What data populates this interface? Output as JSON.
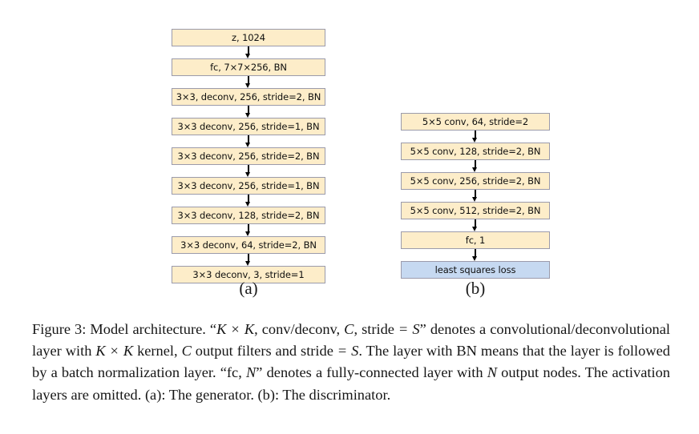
{
  "figure": {
    "generator": {
      "label": "(a)",
      "nodes": [
        {
          "text": "z, 1024",
          "kind": "layer"
        },
        {
          "text": "fc, 7×7×256, BN",
          "kind": "layer"
        },
        {
          "text": "3×3, deconv, 256, stride=2, BN",
          "kind": "layer"
        },
        {
          "text": "3×3 deconv, 256, stride=1, BN",
          "kind": "layer"
        },
        {
          "text": "3×3 deconv, 256, stride=2, BN",
          "kind": "layer"
        },
        {
          "text": "3×3 deconv, 256, stride=1, BN",
          "kind": "layer"
        },
        {
          "text": "3×3 deconv, 128, stride=2, BN",
          "kind": "layer"
        },
        {
          "text": "3×3 deconv, 64, stride=2, BN",
          "kind": "layer"
        },
        {
          "text": "3×3 deconv, 3, stride=1",
          "kind": "layer"
        }
      ]
    },
    "discriminator": {
      "label": "(b)",
      "nodes": [
        {
          "text": "5×5 conv, 64, stride=2",
          "kind": "layer"
        },
        {
          "text": "5×5 conv, 128, stride=2, BN",
          "kind": "layer"
        },
        {
          "text": "5×5 conv, 256, stride=2, BN",
          "kind": "layer"
        },
        {
          "text": "5×5 conv, 512, stride=2, BN",
          "kind": "layer"
        },
        {
          "text": "fc, 1",
          "kind": "layer"
        },
        {
          "text": "least squares loss",
          "kind": "loss"
        }
      ]
    },
    "colors": {
      "layer_fill": "#fdedc9",
      "loss_fill": "#c6d9f1",
      "node_border": "#9b9bab",
      "arrow": "#000000"
    }
  },
  "caption": {
    "number": "Figure 3:",
    "segments": [
      {
        "t": "Figure 3:",
        "s": "plain"
      },
      {
        "t": " Model architecture. “",
        "s": "plain"
      },
      {
        "t": "K",
        "s": "math"
      },
      {
        "t": " × ",
        "s": "op"
      },
      {
        "t": "K",
        "s": "math"
      },
      {
        "t": ", conv/deconv, ",
        "s": "plain"
      },
      {
        "t": "C",
        "s": "math"
      },
      {
        "t": ", stride ",
        "s": "plain"
      },
      {
        "t": "= ",
        "s": "op"
      },
      {
        "t": "S",
        "s": "math"
      },
      {
        "t": "” denotes a convolutional/deconvolutional layer with ",
        "s": "plain"
      },
      {
        "t": "K",
        "s": "math"
      },
      {
        "t": " × ",
        "s": "op"
      },
      {
        "t": "K",
        "s": "math"
      },
      {
        "t": " kernel, ",
        "s": "plain"
      },
      {
        "t": "C",
        "s": "math"
      },
      {
        "t": " output filters and stride ",
        "s": "plain"
      },
      {
        "t": "= ",
        "s": "op"
      },
      {
        "t": "S",
        "s": "math"
      },
      {
        "t": ". The layer with BN means that the layer is followed by a batch normalization layer. “fc, ",
        "s": "plain"
      },
      {
        "t": "N",
        "s": "math"
      },
      {
        "t": "” denotes a fully-connected layer with ",
        "s": "plain"
      },
      {
        "t": "N",
        "s": "math"
      },
      {
        "t": " output nodes. The activation layers are omitted. (a): The generator. (b): The discriminator.",
        "s": "plain"
      }
    ],
    "plain_text": "Figure 3: Model architecture. “K × K, conv/deconv, C, stride = S” denotes a convolutional/deconvolutional layer with K × K kernel, C output filters and stride = S. The layer with BN means that the layer is followed by a batch normalization layer. “fc, N” denotes a fully-connected layer with N output nodes. The activation layers are omitted. (a): The generator. (b): The discriminator."
  }
}
